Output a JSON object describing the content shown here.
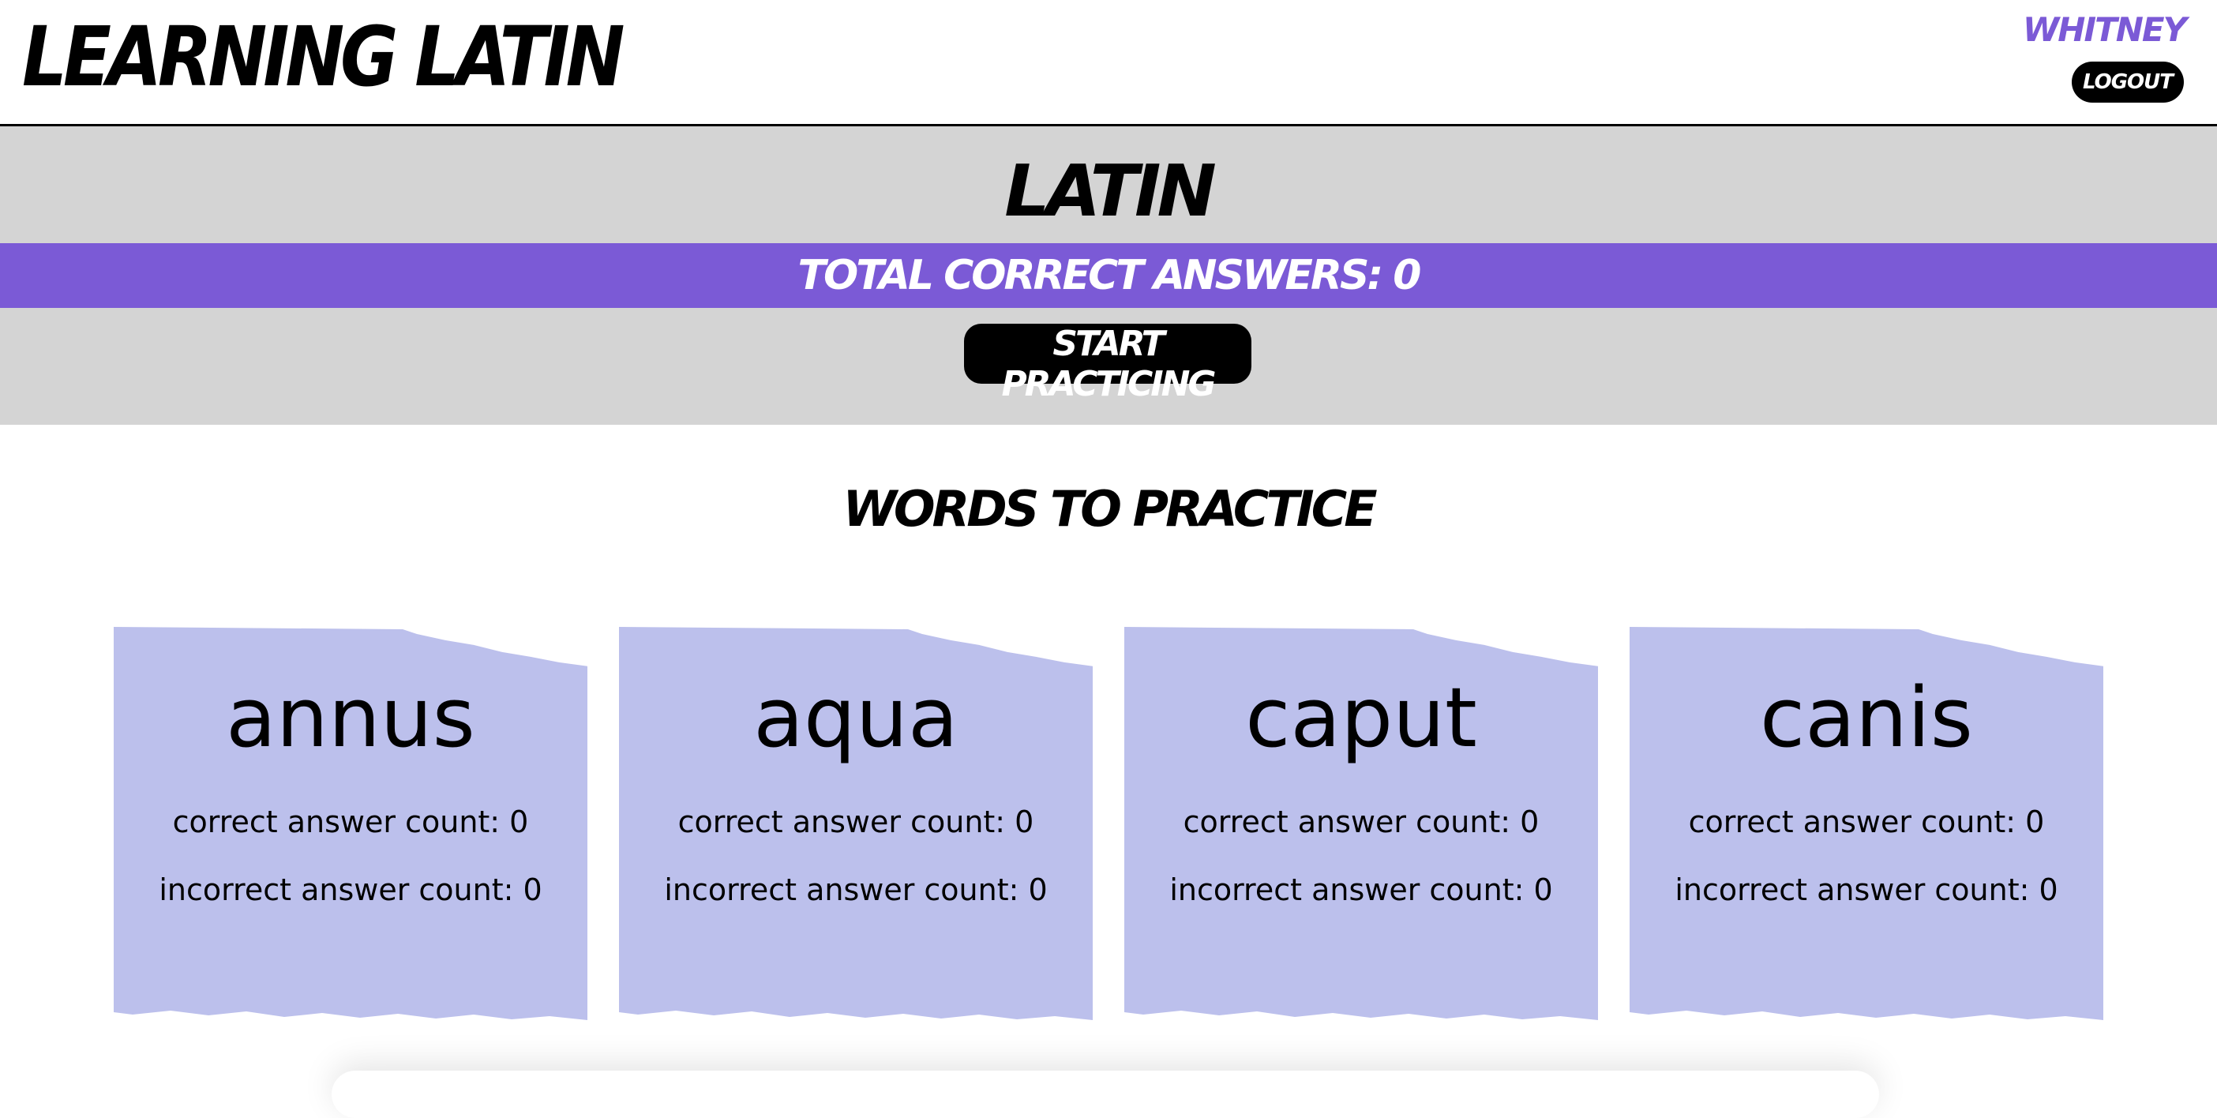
{
  "header": {
    "app_title": "LEARNING LATIN",
    "user_name": "WHITNEY",
    "logout_label": "LOGOUT"
  },
  "language": {
    "name": "LATIN",
    "total_correct_text": "TOTAL CORRECT ANSWERS: 0",
    "start_label": "START PRACTICING"
  },
  "words_section": {
    "title": "WORDS TO PRACTICE",
    "cards": [
      {
        "word": "annus",
        "correct_text": "correct answer count: 0",
        "incorrect_text": "incorrect answer count: 0"
      },
      {
        "word": "aqua",
        "correct_text": "correct answer count: 0",
        "incorrect_text": "incorrect answer count: 0"
      },
      {
        "word": "caput",
        "correct_text": "correct answer count: 0",
        "incorrect_text": "incorrect answer count: 0"
      },
      {
        "word": "canis",
        "correct_text": "correct answer count: 0",
        "incorrect_text": "incorrect answer count: 0"
      }
    ]
  },
  "colors": {
    "accent": "#7b5ad6",
    "panel_bg": "#d4d4d4",
    "card_bg": "#bcc0ec",
    "button_bg": "#000000"
  }
}
